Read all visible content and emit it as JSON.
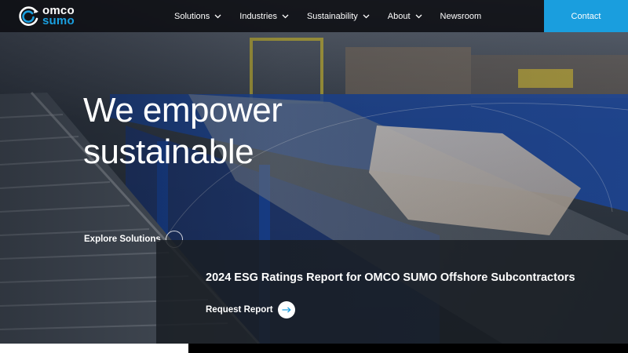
{
  "brand": {
    "name_line1": "omco",
    "name_line2": "sumo",
    "accent_color": "#1a9ede"
  },
  "nav": {
    "items": [
      {
        "label": "Solutions",
        "has_dropdown": true
      },
      {
        "label": "Industries",
        "has_dropdown": true
      },
      {
        "label": "Sustainability",
        "has_dropdown": true
      },
      {
        "label": "About",
        "has_dropdown": true
      },
      {
        "label": "Newsroom",
        "has_dropdown": false
      }
    ],
    "contact_label": "Contact"
  },
  "hero": {
    "headline_line1": "We empower",
    "headline_line2": "sustainable",
    "cta_label": "Explore Solutions"
  },
  "report": {
    "title": "2024 ESG Ratings Report for OMCO SUMO Offshore Subcontractors",
    "cta_label": "Request Report",
    "cta_icon": "arrow-right-icon"
  }
}
